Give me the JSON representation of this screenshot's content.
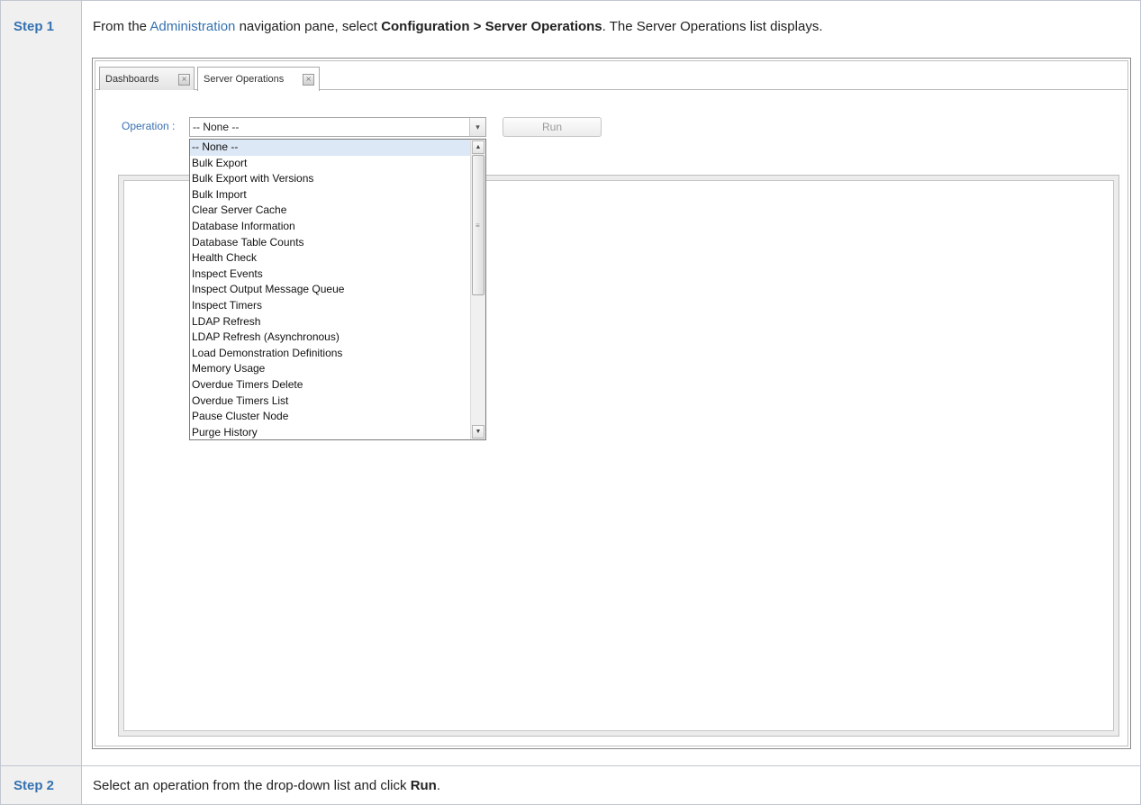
{
  "steps": [
    {
      "label": "Step 1",
      "instruction": {
        "pre": "From the ",
        "link": "Administration",
        "mid": " navigation pane, select ",
        "bold": "Configuration > Server Operations",
        "post": ". The Server Operations list displays."
      }
    },
    {
      "label": "Step 2",
      "instruction": {
        "pre": "Select an operation from the drop-down list and click ",
        "bold": "Run",
        "post": "."
      }
    }
  ],
  "screenshot": {
    "tabs": [
      {
        "label": "Dashboards",
        "close": "×"
      },
      {
        "label": "Server Operations",
        "close": "×"
      }
    ],
    "operation_label": "Operation :",
    "operation_value": "-- None --",
    "run_label": "Run",
    "dropdown_arrow": "▾",
    "dropdown_items": [
      "-- None --",
      "Bulk Export",
      "Bulk Export with Versions",
      "Bulk Import",
      "Clear Server Cache",
      "Database Information",
      "Database Table Counts",
      "Health Check",
      "Inspect Events",
      "Inspect Output Message Queue",
      "Inspect Timers",
      "LDAP Refresh",
      "LDAP Refresh (Asynchronous)",
      "Load Demonstration Definitions",
      "Memory Usage",
      "Overdue Timers Delete",
      "Overdue Timers List",
      "Pause Cluster Node",
      "Purge History"
    ],
    "selected_index": 0,
    "scroll_up": "▲",
    "scroll_down": "▼",
    "scroll_grip": "≡"
  }
}
